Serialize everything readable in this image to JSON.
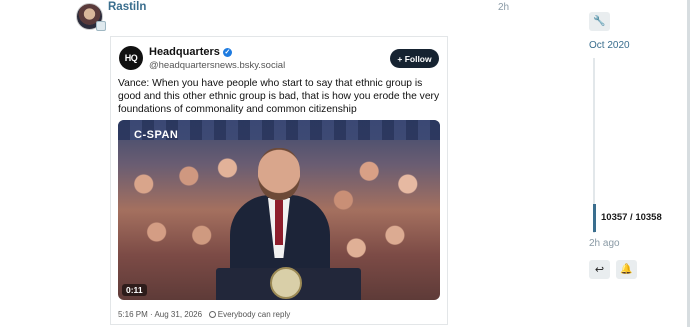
{
  "post": {
    "username": "Rastiln",
    "age": "2h"
  },
  "embed": {
    "logo_text": "HQ",
    "author_name": "Headquarters",
    "author_handle": "@headquartersnews.bsky.social",
    "follow_label": "+ Follow",
    "text": "Vance: When you have people who start to say that ethnic group is good and this other ethnic group is bad, that is how you erode the very foundations of commonality and common citizenship",
    "video": {
      "network_logo": "C-SPAN",
      "duration": "0:11"
    },
    "timestamp": "5:16 PM · Aug 31, 2026",
    "reply_setting": "Everybody can reply"
  },
  "timeline": {
    "top_date": "Oct 2020",
    "position": "10357 / 10358",
    "bottom_date": "2h ago",
    "progress_fraction": 0.9999
  },
  "colors": {
    "link": "#3a6e8e",
    "verified": "#1e7be0",
    "follow_bg": "#162331"
  },
  "icons": {
    "admin": "wrench-icon",
    "reply": "reply-icon",
    "notifications": "bell-icon",
    "verified": "verified-check-icon",
    "reply_setting": "globe-icon"
  }
}
